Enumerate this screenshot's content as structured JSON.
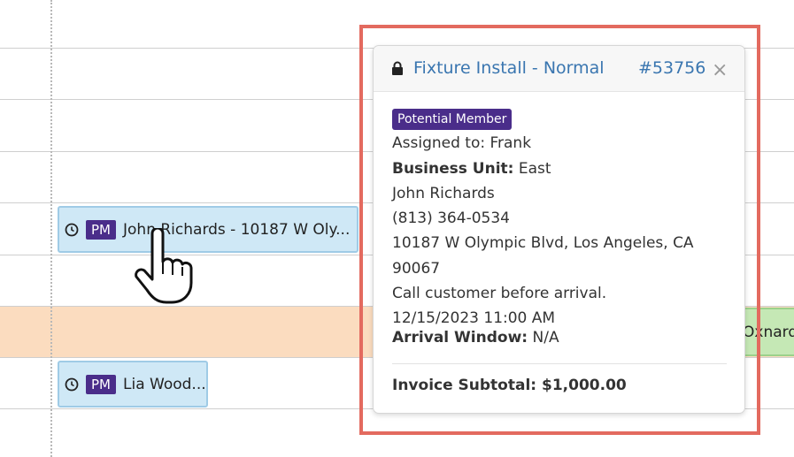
{
  "events": [
    {
      "badge": "PM",
      "title": "John Richards - 10187 W Oly..."
    },
    {
      "badge": "PM",
      "title": "Lia Wood..."
    }
  ],
  "green_event": {
    "title": "Oxnard"
  },
  "popover": {
    "title": "Fixture Install - Normal",
    "number": "#53756",
    "close": "×",
    "badge": "Potential Member",
    "assigned": "Assigned to: Frank",
    "business_unit_label": "Business Unit:",
    "business_unit_value": " East",
    "customer": "John Richards",
    "phone": "(813) 364-0534",
    "address": "10187 W Olympic Blvd, Los Angeles, CA 90067",
    "note": "Call customer before arrival.",
    "datetime": "12/15/2023 11:00 AM",
    "arrival_label": "Arrival Window:",
    "arrival_value": " N/A",
    "subtotal": "Invoice Subtotal: $1,000.00"
  },
  "colors": {
    "accent": "#3a76b0",
    "badge": "#4a2d8a",
    "highlight": "#e36a5f"
  }
}
